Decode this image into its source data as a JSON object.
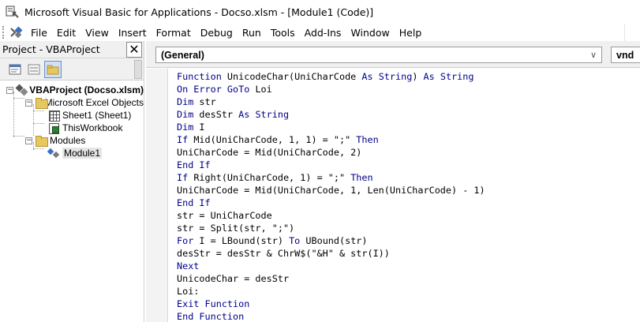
{
  "window": {
    "title": "Microsoft Visual Basic for Applications - Docso.xlsm - [Module1 (Code)]"
  },
  "menu": [
    "File",
    "Edit",
    "View",
    "Insert",
    "Format",
    "Debug",
    "Run",
    "Tools",
    "Add-Ins",
    "Window",
    "Help"
  ],
  "project_pane": {
    "title": "Project - VBAProject",
    "close_label": "✕",
    "toolbar": [
      "view-code-icon",
      "view-object-icon",
      "toggle-folders-icon"
    ],
    "tree": {
      "root": "VBAProject (Docso.xlsm)",
      "excel_objects": "Microsoft Excel Objects",
      "sheet1": "Sheet1 (Sheet1)",
      "thisworkbook": "ThisWorkbook",
      "modules": "Modules",
      "module1": "Module1"
    }
  },
  "code_window": {
    "object_combo": "(General)",
    "proc_combo": "vnd",
    "colors": {
      "keyword": "#00008b",
      "text": "#000000"
    },
    "lines": [
      [
        {
          "t": "Function ",
          "k": true
        },
        {
          "t": "UnicodeChar(UniCharCode "
        },
        {
          "t": "As String",
          "k": true
        },
        {
          "t": ") "
        },
        {
          "t": "As String",
          "k": true
        }
      ],
      [
        {
          "t": "On Error GoTo",
          "k": true
        },
        {
          "t": " Loi"
        }
      ],
      [
        {
          "t": "Dim",
          "k": true
        },
        {
          "t": " str"
        }
      ],
      [
        {
          "t": "Dim",
          "k": true
        },
        {
          "t": " desStr "
        },
        {
          "t": "As String",
          "k": true
        }
      ],
      [
        {
          "t": "Dim",
          "k": true
        },
        {
          "t": " I"
        }
      ],
      [
        {
          "t": "If",
          "k": true
        },
        {
          "t": " Mid(UniCharCode, 1, 1) = \";\" "
        },
        {
          "t": "Then",
          "k": true
        }
      ],
      [
        {
          "t": "UniCharCode = Mid(UniCharCode, 2)"
        }
      ],
      [
        {
          "t": "End If",
          "k": true
        }
      ],
      [
        {
          "t": "If",
          "k": true
        },
        {
          "t": " Right(UniCharCode, 1) = \";\" "
        },
        {
          "t": "Then",
          "k": true
        }
      ],
      [
        {
          "t": "UniCharCode = Mid(UniCharCode, 1, Len(UniCharCode) - 1)"
        }
      ],
      [
        {
          "t": "End If",
          "k": true
        }
      ],
      [
        {
          "t": "str = UniCharCode"
        }
      ],
      [
        {
          "t": "str = Split(str, \";\")"
        }
      ],
      [
        {
          "t": "For",
          "k": true
        },
        {
          "t": " I = LBound(str) "
        },
        {
          "t": "To",
          "k": true
        },
        {
          "t": " UBound(str)"
        }
      ],
      [
        {
          "t": "desStr = desStr & ChrW$(\"&H\" & str(I))"
        }
      ],
      [
        {
          "t": "Next",
          "k": true
        }
      ],
      [
        {
          "t": "UnicodeChar = desStr"
        }
      ],
      [
        {
          "t": "Loi:"
        }
      ],
      [
        {
          "t": "Exit Function",
          "k": true
        }
      ],
      [
        {
          "t": "End Function",
          "k": true
        }
      ]
    ]
  }
}
